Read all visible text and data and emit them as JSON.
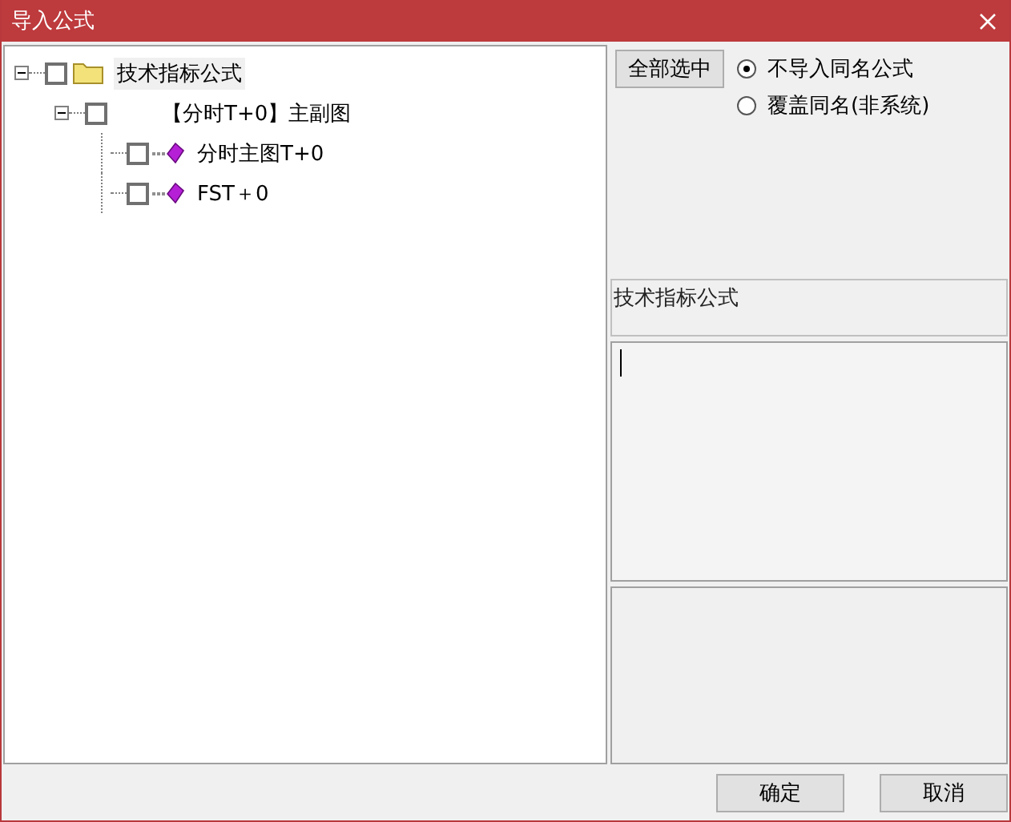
{
  "window": {
    "title": "导入公式"
  },
  "tree": [
    {
      "label": "技术指标公式",
      "kind": "folder",
      "expanded": true,
      "checked": false,
      "children": [
        {
          "label": "【分时T+0】主副图",
          "kind": "group",
          "expanded": true,
          "checked": false,
          "children": [
            {
              "label": "分时主图T+0",
              "kind": "formula",
              "checked": false
            },
            {
              "label": "FST＋0",
              "kind": "formula",
              "checked": false
            }
          ]
        }
      ]
    }
  ],
  "select_all_button": "全部选中",
  "options": [
    {
      "label": "不导入同名公式",
      "selected": true
    },
    {
      "label": "覆盖同名(非系统)",
      "selected": false
    }
  ],
  "category_label": "技术指标公式",
  "buttons": [
    "确定",
    "取消"
  ]
}
